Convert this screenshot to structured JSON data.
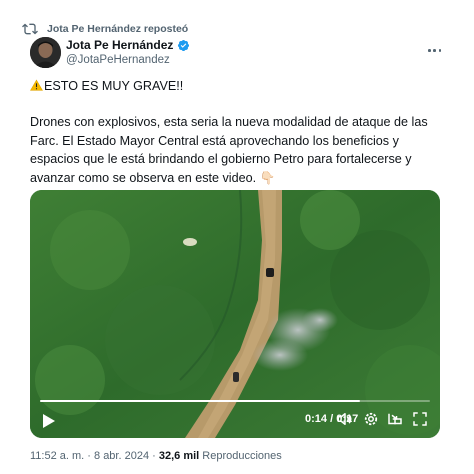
{
  "repost": {
    "label": "Jota Pe Hernández reposteó",
    "icon": "repost-icon"
  },
  "author": {
    "name": "Jota Pe Hernández",
    "handle": "@JotaPeHernandez",
    "verified": true,
    "verified_color": "#1d9bf0"
  },
  "tweet": {
    "headline": "ESTO ES MUY GRAVE!!",
    "body": "Drones con explosivos, esta seria la nueva modalidad de ataque de las Farc. El Estado Mayor Central está aprovechando los beneficios y espacios que le está brindando el gobierno Petro para fortalecerse y avanzar como se observa en este video. 👇🏻"
  },
  "video": {
    "current_time": "0:14",
    "separator": "/",
    "duration": "0:17",
    "progress": 0.82
  },
  "footer": {
    "time": "11:52 a. m.",
    "dot1": "·",
    "date": "8 abr. 2024",
    "dot2": "·",
    "views": "32,6 mil",
    "views_label": "Reproducciones"
  },
  "colors": {
    "secondary_text": "#536471",
    "primary_text": "#0f1419"
  }
}
